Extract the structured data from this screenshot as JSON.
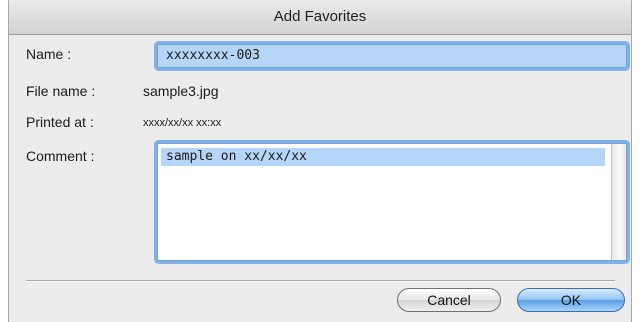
{
  "window": {
    "title": "Add Favorites"
  },
  "form": {
    "name_label": "Name :",
    "name_value": "xxxxxxxx-003",
    "filename_label": "File name :",
    "filename_value": "sample3.jpg",
    "printed_label": "Printed at :",
    "printed_value": "xxxx/xx/xx  xx:xx",
    "comment_label": "Comment :",
    "comment_value": "sample on xx/xx/xx"
  },
  "buttons": {
    "cancel": "Cancel",
    "ok": "OK"
  }
}
